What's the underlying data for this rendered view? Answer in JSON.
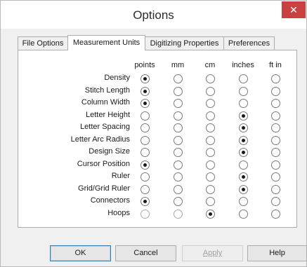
{
  "window": {
    "title": "Options",
    "close_glyph": "✕"
  },
  "tabs": [
    {
      "label": "File Options",
      "active": false
    },
    {
      "label": "Measurement Units",
      "active": true
    },
    {
      "label": "Digitizing Properties",
      "active": false
    },
    {
      "label": "Preferences",
      "active": false
    }
  ],
  "columns": [
    "points",
    "mm",
    "cm",
    "inches",
    "ft in"
  ],
  "rows": [
    {
      "label": "Density",
      "selected": 0,
      "enabled": [
        true,
        true,
        true,
        true,
        true
      ]
    },
    {
      "label": "Stitch Length",
      "selected": 0,
      "enabled": [
        true,
        true,
        true,
        true,
        true
      ]
    },
    {
      "label": "Column Width",
      "selected": 0,
      "enabled": [
        true,
        true,
        true,
        true,
        true
      ]
    },
    {
      "label": "Letter Height",
      "selected": 3,
      "enabled": [
        true,
        true,
        true,
        true,
        true
      ]
    },
    {
      "label": "Letter Spacing",
      "selected": 3,
      "enabled": [
        true,
        true,
        true,
        true,
        true
      ]
    },
    {
      "label": "Letter Arc Radius",
      "selected": 3,
      "enabled": [
        true,
        true,
        true,
        true,
        true
      ]
    },
    {
      "label": "Design Size",
      "selected": 3,
      "enabled": [
        true,
        true,
        true,
        true,
        true
      ]
    },
    {
      "label": "Cursor Position",
      "selected": 0,
      "enabled": [
        true,
        true,
        true,
        true,
        true
      ]
    },
    {
      "label": "Ruler",
      "selected": 3,
      "enabled": [
        true,
        true,
        true,
        true,
        true
      ]
    },
    {
      "label": "Grid/Grid Ruler",
      "selected": 3,
      "enabled": [
        true,
        true,
        true,
        true,
        true
      ]
    },
    {
      "label": "Connectors",
      "selected": 0,
      "enabled": [
        true,
        true,
        true,
        true,
        true
      ]
    },
    {
      "label": "Hoops",
      "selected": 2,
      "enabled": [
        false,
        false,
        true,
        true,
        true
      ]
    }
  ],
  "buttons": {
    "ok": "OK",
    "cancel": "Cancel",
    "apply": "Apply",
    "help": "Help"
  },
  "colors": {
    "close_button": "#c94040",
    "default_button_border": "#3c7fb1"
  }
}
